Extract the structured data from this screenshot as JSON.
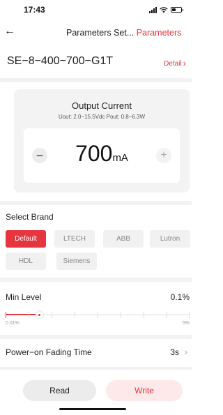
{
  "status_bar": {
    "time": "17:43",
    "icons": [
      "signal-icon",
      "wifi-icon",
      "battery-icon"
    ]
  },
  "nav": {
    "back_icon": "←",
    "title": "Parameters Set...",
    "title_accent": "Parameters"
  },
  "device": {
    "name": "SE−8−400−700−G1T",
    "detail_label": "Detail",
    "detail_chevron": "›"
  },
  "output_current": {
    "title": "Output Current",
    "specs": "Uout: 2.0−15.5Vdc   Pout: 0.8−6.3W",
    "value": "700",
    "unit": "mA",
    "minus_icon": "−",
    "plus_icon": "+"
  },
  "brand": {
    "label": "Select Brand",
    "options": [
      "Default",
      "LTECH",
      "ABB",
      "Lutron",
      "HDL",
      "Siemens"
    ],
    "selected": "Default"
  },
  "min_level": {
    "label": "Min Level",
    "value": "0.1%",
    "slider_min": "0.01%",
    "slider_max": "5%",
    "slider_fraction": 0.18
  },
  "fading": {
    "label": "Power−on Fading Time",
    "value": "3s",
    "chevron": "›"
  },
  "actions": {
    "read_label": "Read",
    "write_label": "Write"
  },
  "colors": {
    "accent": "#e5353f",
    "write_bg": "#fde9ea",
    "card_bg": "#f3f3f3"
  }
}
